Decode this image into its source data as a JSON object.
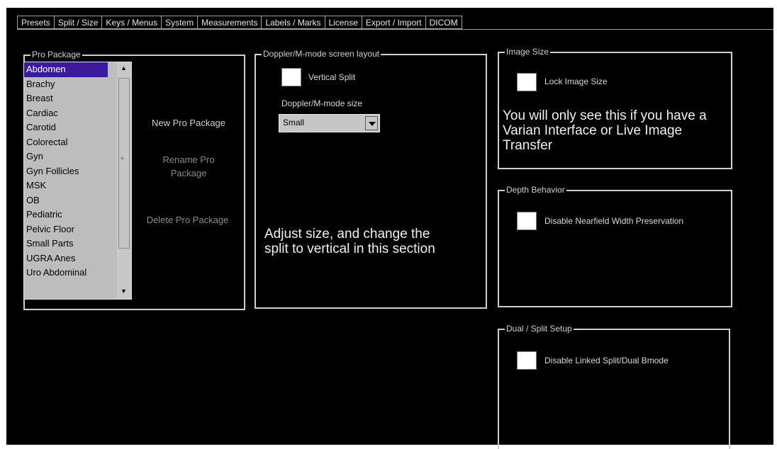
{
  "tabs": [
    "Presets",
    "Split / Size",
    "Keys / Menus",
    "System",
    "Measurements",
    "Labels / Marks",
    "License",
    "Export / Import",
    "DICOM"
  ],
  "pro_package": {
    "title": "Pro Package",
    "items": [
      "Abdomen",
      "Brachy",
      "Breast",
      "Cardiac",
      "Carotid",
      "Colorectal",
      "Gyn",
      "Gyn Follicles",
      "MSK",
      "OB",
      "Pediatric",
      "Pelvic Floor",
      "Small Parts",
      "UGRA Anes",
      "Uro Abdominal"
    ],
    "selected": "Abdomen",
    "new_label": "New Pro Package",
    "rename_label": "Rename Pro Package",
    "delete_label": "Delete Pro Package"
  },
  "doppler": {
    "title": "Doppler/M-mode screen layout",
    "vertical_split_label": "Vertical Split",
    "size_label": "Doppler/M-mode size",
    "size_value": "Small",
    "note": "Adjust size, and change the split to vertical in this section"
  },
  "image_size": {
    "title": "Image Size",
    "lock_label": "Lock Image Size",
    "note": "You will only see this if you have a Varian Interface or Live Image Transfer"
  },
  "depth": {
    "title": "Depth Behavior",
    "disable_label": "Disable Nearfield Width Preservation"
  },
  "dual": {
    "title": "Dual / Split Setup",
    "disable_label": "Disable Linked Split/Dual Bmode"
  }
}
